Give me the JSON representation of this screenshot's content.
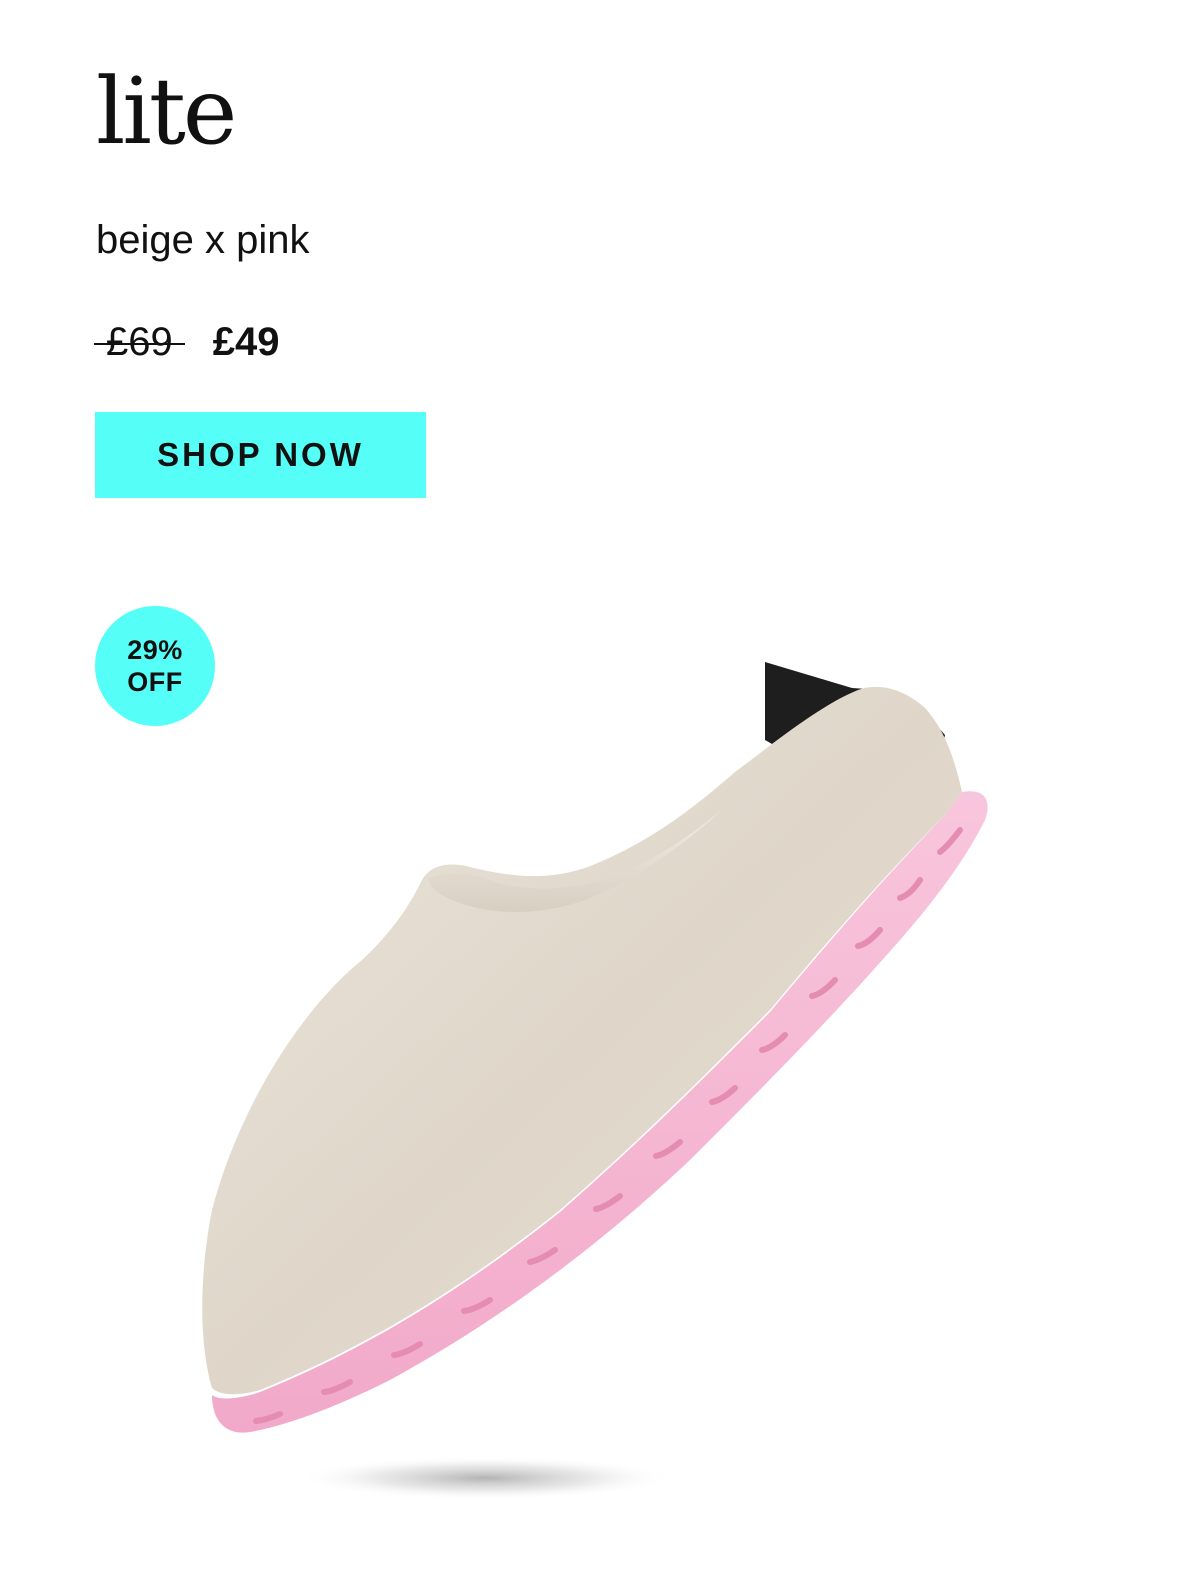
{
  "product": {
    "name": "lite",
    "colorway": "beige x pink",
    "price_original": "£69",
    "price_sale": "£49",
    "discount_line1": "29%",
    "discount_line2": "OFF"
  },
  "cta": {
    "label": "SHOP NOW"
  },
  "colors": {
    "accent": "#55fef6",
    "text": "#111111",
    "felt": "#e4dcd1",
    "sole": "#f4b2d0",
    "heel_tab": "#1e1e1e"
  }
}
